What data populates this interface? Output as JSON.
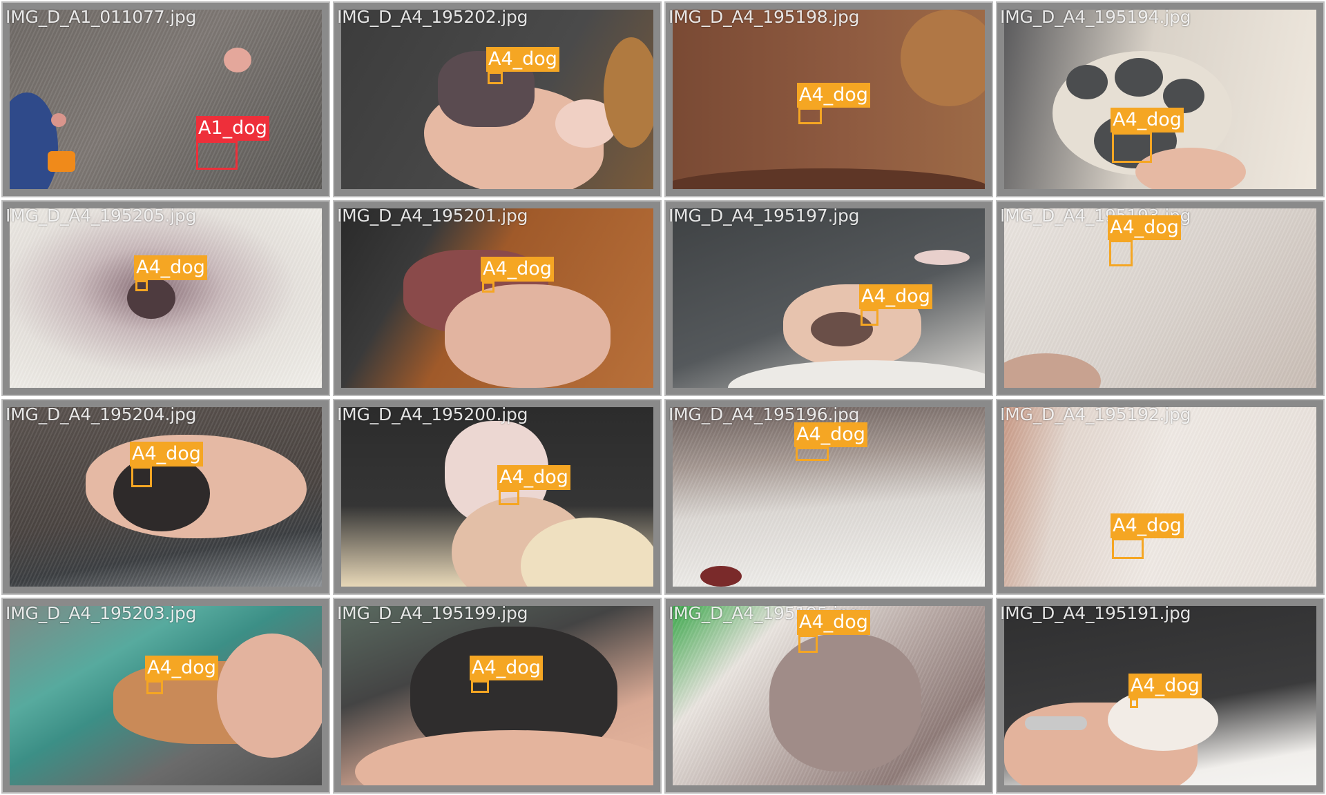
{
  "colors": {
    "label_a4": "#f5a623",
    "label_a1": "#ee2f3a",
    "tile_border": "#bdbdbd",
    "tile_bg": "#8a8a8a"
  },
  "tiles": [
    {
      "filename": "IMG_D_A1_011077.jpg",
      "label": "A1_dog",
      "scene": "gray fur with skin lump"
    },
    {
      "filename": "IMG_D_A4_195202.jpg",
      "label": "A4_dog",
      "scene": "hand holding paw"
    },
    {
      "filename": "IMG_D_A4_195198.jpg",
      "label": "A4_dog",
      "scene": "brown skin"
    },
    {
      "filename": "IMG_D_A4_195194.jpg",
      "label": "A4_dog",
      "scene": "paw pads"
    },
    {
      "filename": "IMG_D_A4_195205.jpg",
      "label": "A4_dog",
      "scene": "white fur skin"
    },
    {
      "filename": "IMG_D_A4_195201.jpg",
      "label": "A4_dog",
      "scene": "red paw in hand"
    },
    {
      "filename": "IMG_D_A4_195197.jpg",
      "label": "A4_dog",
      "scene": "paw with gray background"
    },
    {
      "filename": "IMG_D_A4_195193.jpg",
      "label": "A4_dog",
      "scene": "white belly"
    },
    {
      "filename": "IMG_D_A4_195204.jpg",
      "label": "A4_dog",
      "scene": "dark curly fur paw"
    },
    {
      "filename": "IMG_D_A4_195200.jpg",
      "label": "A4_dog",
      "scene": "light paw held"
    },
    {
      "filename": "IMG_D_A4_195196.jpg",
      "label": "A4_dog",
      "scene": "white fur belly"
    },
    {
      "filename": "IMG_D_A4_195192.jpg",
      "label": "A4_dog",
      "scene": "pale skin"
    },
    {
      "filename": "IMG_D_A4_195203.jpg",
      "label": "A4_dog",
      "scene": "leg held over table"
    },
    {
      "filename": "IMG_D_A4_195199.jpg",
      "label": "A4_dog",
      "scene": "black paw in hand"
    },
    {
      "filename": "IMG_D_A4_195195.jpg",
      "label": "A4_dog",
      "scene": "skin fold with green"
    },
    {
      "filename": "IMG_D_A4_195191.jpg",
      "label": "A4_dog",
      "scene": "small paw held"
    }
  ]
}
